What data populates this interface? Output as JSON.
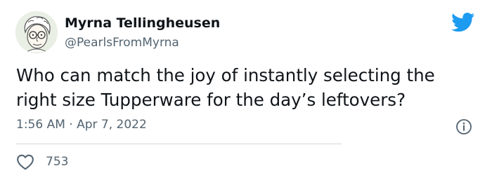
{
  "author": {
    "display_name": "Myrna Tellingheusen",
    "handle": "@PearlsFromMyrna"
  },
  "tweet": {
    "text": "Who can match the joy of instantly selecting the right size Tupperware for the day’s leftovers?",
    "timestamp": "1:56 AM · Apr 7, 2022"
  },
  "engagement": {
    "likes": "753"
  },
  "icons": {
    "brand": "twitter-bird-icon",
    "info": "info-icon",
    "like": "heart-icon"
  },
  "colors": {
    "brand": "#1d9bf0",
    "text": "#0f1419",
    "secondary_text": "#536471",
    "divider": "#cfd9de"
  }
}
